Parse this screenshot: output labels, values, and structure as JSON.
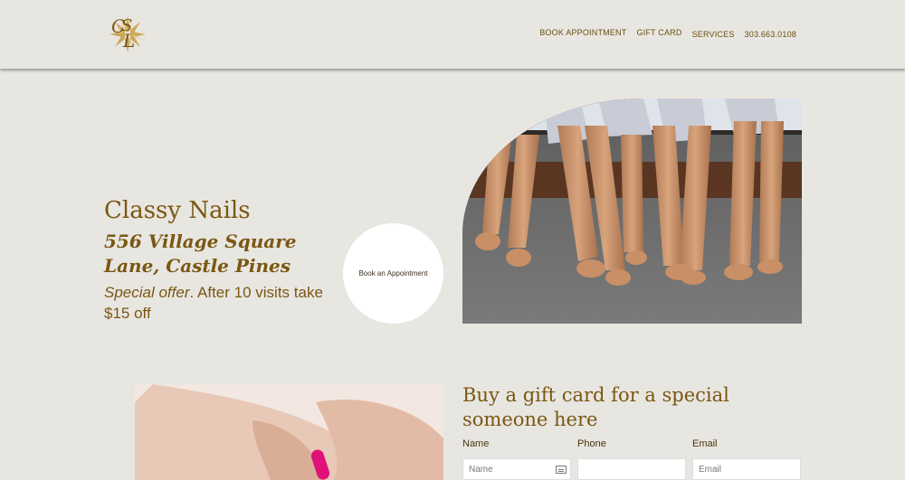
{
  "header": {
    "nav": [
      {
        "label": "BOOK APPOINTMENT"
      },
      {
        "label": "GIFT CARD"
      },
      {
        "label": "SERVICES"
      },
      {
        "label": "303.663.0108"
      }
    ]
  },
  "hero": {
    "name": "Classy Nails",
    "address": "556 Village Square Lane, Castle Pines",
    "offer_label": "Special offer",
    "offer_text": ". After 10 visits take $15 off",
    "book_button": "Book an Appointment"
  },
  "gift": {
    "title": "Buy a gift card for a special someone here",
    "fields": [
      {
        "label": "Name",
        "placeholder": "Name"
      },
      {
        "label": "Phone",
        "placeholder": ""
      },
      {
        "label": "Email",
        "placeholder": "Email"
      }
    ]
  },
  "colors": {
    "background": "#e8e6e1",
    "brand": "#7a5712",
    "white": "#ffffff"
  }
}
